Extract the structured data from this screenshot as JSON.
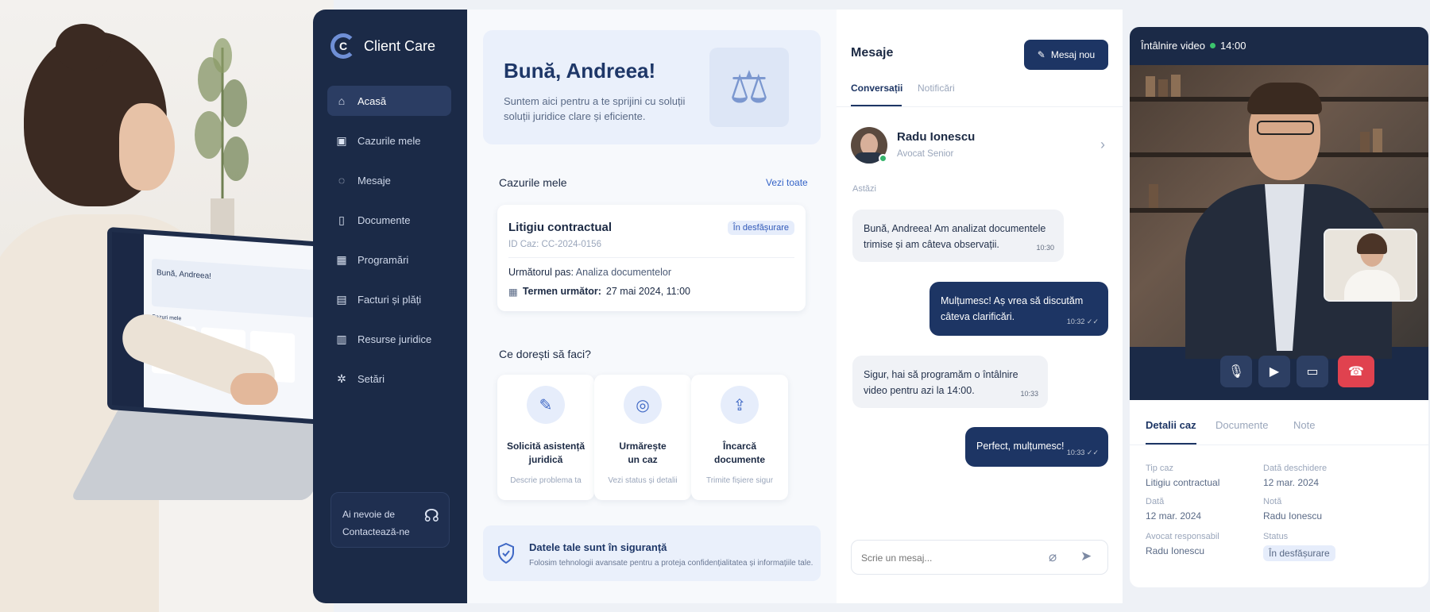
{
  "app": {
    "name": "Client Care",
    "logo_letter": "C"
  },
  "sidebar": {
    "items": [
      {
        "label": "Acasă",
        "icon": "home-icon",
        "glyph": "⌂"
      },
      {
        "label": "Cazurile mele",
        "icon": "briefcase-icon",
        "glyph": "▣"
      },
      {
        "label": "Mesaje",
        "icon": "chat-icon",
        "glyph": "◌"
      },
      {
        "label": "Documente",
        "icon": "document-icon",
        "glyph": "▯"
      },
      {
        "label": "Programări",
        "icon": "calendar-icon",
        "glyph": "▦"
      },
      {
        "label": "Facturi și plăți",
        "icon": "invoice-icon",
        "glyph": "▤"
      },
      {
        "label": "Resurse juridice",
        "icon": "book-icon",
        "glyph": "▥"
      },
      {
        "label": "Setări",
        "icon": "gear-icon",
        "glyph": "✲"
      }
    ],
    "help": {
      "line1": "Ai nevoie de",
      "line2": "Contactează-ne",
      "icon": "headset-icon"
    }
  },
  "laptop_screen": {
    "greeting": "Bună, Andreea!",
    "section": "Cazuri mele"
  },
  "welcome": {
    "title": "Bună, Andreea!",
    "text": "Suntem aici pentru a te sprijini cu soluții soluții juridice clare și eficiente.",
    "icon": "scale-icon"
  },
  "cases": {
    "title": "Cazurile mele",
    "view_all": "Vezi toate",
    "card": {
      "name": "Litigiu contractual",
      "status": "În desfășurare",
      "id": "ID Caz: CC-2024-0156",
      "next_label": "Următorul pas:",
      "next_value": "Analiza documentelor",
      "deadline_label": "Termen următor:",
      "deadline_value": "27 mai 2024, 11:00"
    }
  },
  "actions": {
    "title": "Ce dorești să faci?",
    "items": [
      {
        "title1": "Solicită asistență",
        "title2": "juridică",
        "sub": "Descrie problema ta",
        "icon": "edit-document-icon"
      },
      {
        "title1": "Urmărește",
        "title2": "un caz",
        "sub": "Vezi status și detalii",
        "icon": "track-icon"
      },
      {
        "title1": "Încarcă",
        "title2": "documente",
        "sub": "Trimite fișiere sigur",
        "icon": "upload-icon"
      }
    ]
  },
  "secure": {
    "title": "Datele tale sunt în siguranță",
    "text": "Folosim tehnologii avansate pentru a proteja confidențialitatea și informațiile tale."
  },
  "messages": {
    "title": "Mesaje",
    "new_button": "Mesaj nou",
    "tabs": [
      "Conversații",
      "Notificări"
    ],
    "contact": {
      "name": "Radu Ionescu",
      "role": "Avocat Senior"
    },
    "day": "Astăzi",
    "bubbles": [
      {
        "text": "Bună, Andreea! Am analizat documentele trimise și am câteva observații.",
        "time": "10:30",
        "dir": "in"
      },
      {
        "text": "Mulțumesc! Aș vrea să discutăm câteva clarificări.",
        "time": "10:32 ✓✓",
        "dir": "out"
      },
      {
        "text": "Sigur, hai să programăm o întâlnire video pentru azi la 14:00.",
        "time": "10:33",
        "dir": "in"
      },
      {
        "text": "Perfect, mulțumesc!",
        "time": "10:33 ✓✓",
        "dir": "out"
      }
    ],
    "compose_placeholder": "Scrie un mesaj..."
  },
  "video": {
    "title": "Întâlnire video",
    "time": "14:00"
  },
  "details": {
    "tabs": [
      "Detalii caz",
      "Documente",
      "Note"
    ],
    "fields": [
      {
        "label": "Tip caz",
        "value": "Litigiu contractual"
      },
      {
        "label": "Dată deschidere",
        "value": "12 mar. 2024"
      },
      {
        "label": "Dată",
        "value": "12 mar. 2024"
      },
      {
        "label": "Notă",
        "value": "Radu Ionescu"
      },
      {
        "label": "Avocat responsabil",
        "value": "Radu Ionescu"
      },
      {
        "label": "Status",
        "value": "În desfășurare"
      }
    ]
  },
  "colors": {
    "navy": "#1b2a47",
    "accent": "#1d3564",
    "link": "#3463c7",
    "online": "#35b46b",
    "end_call": "#e0424f"
  }
}
